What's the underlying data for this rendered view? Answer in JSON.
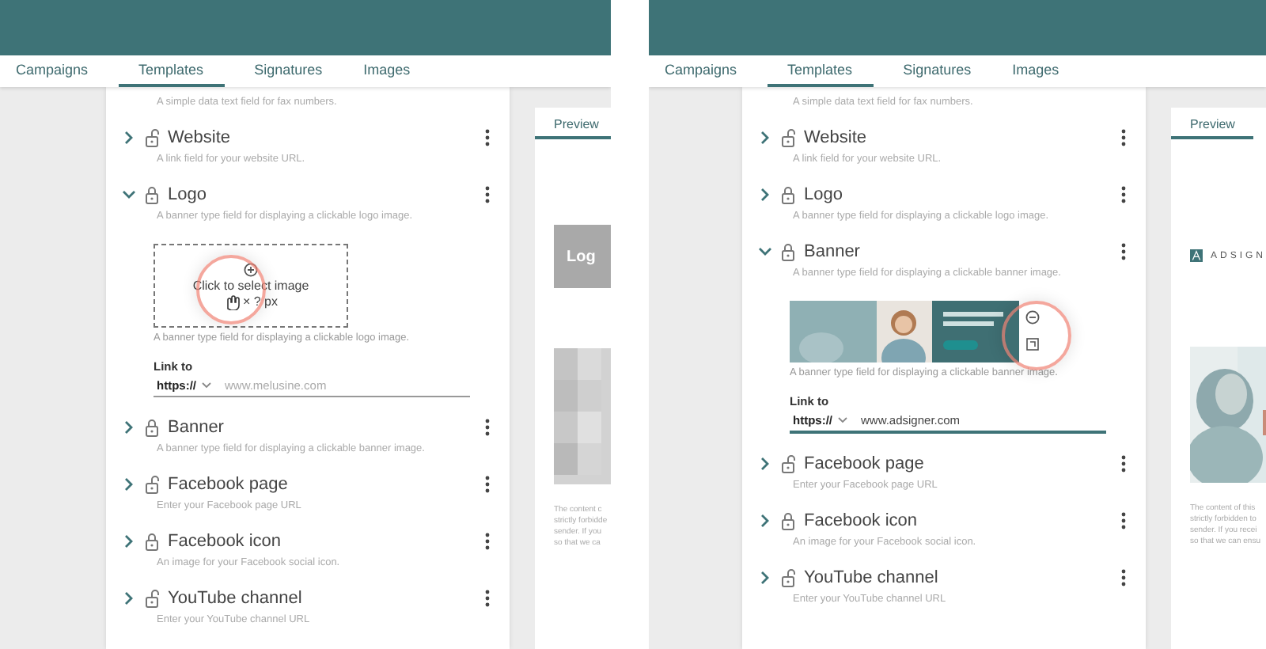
{
  "panels": [
    {
      "tabs": [
        {
          "label": "Campaigns",
          "selected": false
        },
        {
          "label": "Templates",
          "selected": true
        },
        {
          "label": "Signatures",
          "selected": false
        },
        {
          "label": "Images",
          "selected": false
        }
      ],
      "fields": [
        {
          "description": "A simple data text field for fax numbers."
        },
        {
          "title": "Website",
          "description": "A link field for your website URL.",
          "locked": false,
          "expanded": false
        },
        {
          "title": "Logo",
          "description": "A banner type field for displaying a clickable logo image.",
          "locked": true,
          "expanded": true,
          "editor": {
            "kind": "upload",
            "prompt": "Click to select image",
            "size": "× ? px",
            "highlighted": true,
            "caption": "A banner type field for displaying a clickable logo image.",
            "link_label": "Link to",
            "protocol": "https://",
            "url": {
              "placeholder": "www.melusine.com"
            },
            "focused": false
          }
        },
        {
          "title": "Banner",
          "description": "A banner type field for displaying a clickable banner image.",
          "locked": true,
          "expanded": false
        },
        {
          "title": "Facebook page",
          "description": "Enter your Facebook page URL",
          "locked": false,
          "expanded": false
        },
        {
          "title": "Facebook icon",
          "description": "An image for your Facebook social icon.",
          "locked": true,
          "expanded": false
        },
        {
          "title": "YouTube channel",
          "description": "Enter your YouTube channel URL",
          "locked": false,
          "expanded": false
        }
      ],
      "preview": {
        "tab": "Preview",
        "logo": {
          "kind": "placeholder",
          "text": "Log"
        },
        "disclaimer": [
          "The content c",
          "strictly forbidde",
          "sender. If you",
          "so that we ca"
        ]
      }
    },
    {
      "tabs": [
        {
          "label": "Campaigns",
          "selected": false
        },
        {
          "label": "Templates",
          "selected": true
        },
        {
          "label": "Signatures",
          "selected": false
        },
        {
          "label": "Images",
          "selected": false
        }
      ],
      "fields": [
        {
          "description": "A simple data text field for fax numbers."
        },
        {
          "title": "Website",
          "description": "A link field for your website URL.",
          "locked": false,
          "expanded": false
        },
        {
          "title": "Logo",
          "description": "A banner type field for displaying a clickable logo image.",
          "locked": true,
          "expanded": false
        },
        {
          "title": "Banner",
          "description": "A banner type field for displaying a clickable banner image.",
          "locked": true,
          "expanded": true,
          "editor": {
            "kind": "banner",
            "highlighted": true,
            "caption": "A banner type field for displaying a clickable banner image.",
            "link_label": "Link to",
            "protocol": "https://",
            "url": {
              "value": "www.adsigner.com"
            },
            "focused": true
          }
        },
        {
          "title": "Facebook page",
          "description": "Enter your Facebook page URL",
          "locked": false,
          "expanded": false
        },
        {
          "title": "Facebook icon",
          "description": "An image for your Facebook social icon.",
          "locked": true,
          "expanded": false
        },
        {
          "title": "YouTube channel",
          "description": "Enter your YouTube channel URL",
          "locked": false,
          "expanded": false
        }
      ],
      "preview": {
        "tab": "Preview",
        "logo": {
          "kind": "brand",
          "text": "ADSIGN"
        },
        "disclaimer": [
          "The content of this",
          "strictly forbidden to",
          "sender. If you recei",
          "so that we can ensu"
        ]
      }
    }
  ]
}
